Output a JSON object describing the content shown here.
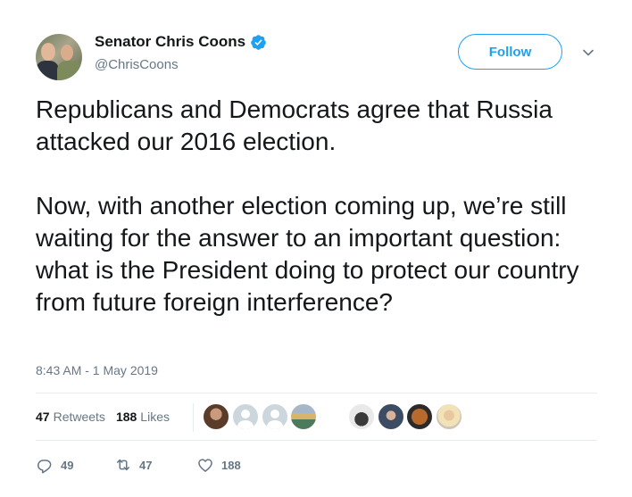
{
  "author": {
    "display_name": "Senator Chris Coons",
    "handle": "@ChrisCoons",
    "verified": true,
    "avatar_icon": "avatar-photo"
  },
  "header": {
    "follow_label": "Follow",
    "menu_icon": "chevron-down-icon"
  },
  "tweet": {
    "text": "Republicans and Democrats agree that Russia attacked our 2016 election.\n\nNow, with another election coming up, we’re still waiting for the answer to an important question: what is the President doing to protect our country from future foreign interference?",
    "timestamp": "8:43 AM - 1 May 2019"
  },
  "stats": {
    "retweets_count": "47",
    "retweets_label": "Retweets",
    "likes_count": "188",
    "likes_label": "Likes"
  },
  "liker_avatars": [
    "woman-photo-avatar",
    "default-avatar",
    "default-avatar",
    "landscape-avatar",
    "dog-statue-avatar",
    "person-avatar",
    "dog-avatar",
    "woman-blonde-avatar"
  ],
  "actions": {
    "reply_count": "49",
    "retweet_count": "47",
    "like_count": "188"
  },
  "colors": {
    "accent": "#1da1f2",
    "text": "#14171a",
    "muted": "#657786",
    "divider": "#e6ecf0"
  }
}
